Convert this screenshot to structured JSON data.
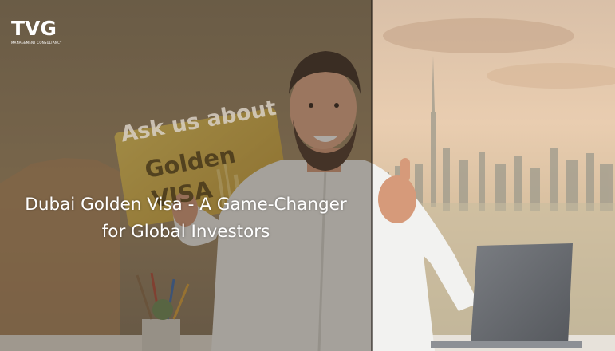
{
  "brand": {
    "logo_text": "TVG",
    "tagline": "MANAGEMENT CONSULTANCY"
  },
  "card": {
    "prompt": "Ask us about",
    "line1": "Golden",
    "line2": "VISA"
  },
  "headline": {
    "line1": "Dubai Golden Visa - A Game-Changer",
    "line2": "for Global Investors"
  }
}
